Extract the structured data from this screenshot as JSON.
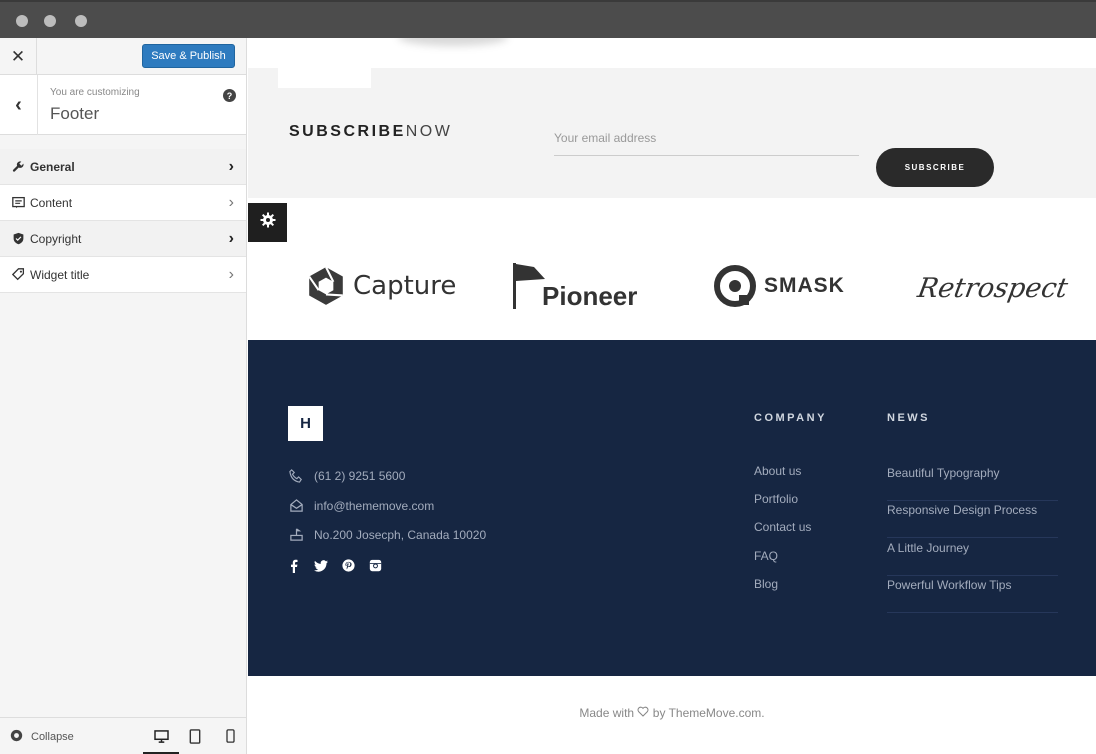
{
  "sidebar": {
    "close_label": "✕",
    "save_label": "Save & Publish",
    "back_label": "‹",
    "subtitle": "You are customizing",
    "title": "Footer",
    "help_label": "?",
    "items": [
      {
        "label": "General",
        "icon": "wrench-icon"
      },
      {
        "label": "Content",
        "icon": "content-icon"
      },
      {
        "label": "Copyright",
        "icon": "shield-icon"
      },
      {
        "label": "Widget title",
        "icon": "tag-icon"
      }
    ],
    "collapse_label": "Collapse"
  },
  "subscribe": {
    "title_bold": "SUBSCRIBE",
    "title_light": "NOW",
    "email_placeholder": "Your email address",
    "button_label": "SUBSCRIBE"
  },
  "logos": [
    "Capture",
    "Pioneer",
    "SMASK",
    "Retrospect"
  ],
  "footer": {
    "logo_letter": "H",
    "phone": "(61 2) 9251 5600",
    "email": "info@thememove.com",
    "address": "No.200 Josecph, Canada 10020",
    "company_heading": "COMPANY",
    "company_links": [
      "About us",
      "Portfolio",
      "Contact us",
      "FAQ",
      "Blog"
    ],
    "news_heading": "NEWS",
    "news_links": [
      "Beautiful Typography",
      "Responsive Design Process",
      "A Little Journey",
      "Powerful Workflow Tips"
    ]
  },
  "credit": {
    "prefix": "Made with",
    "suffix": "by ThemeMove.com."
  },
  "colors": {
    "save_button": "#2e7bbf",
    "footer_bg": "#162642",
    "subscribe_button": "#2a2a2a"
  }
}
